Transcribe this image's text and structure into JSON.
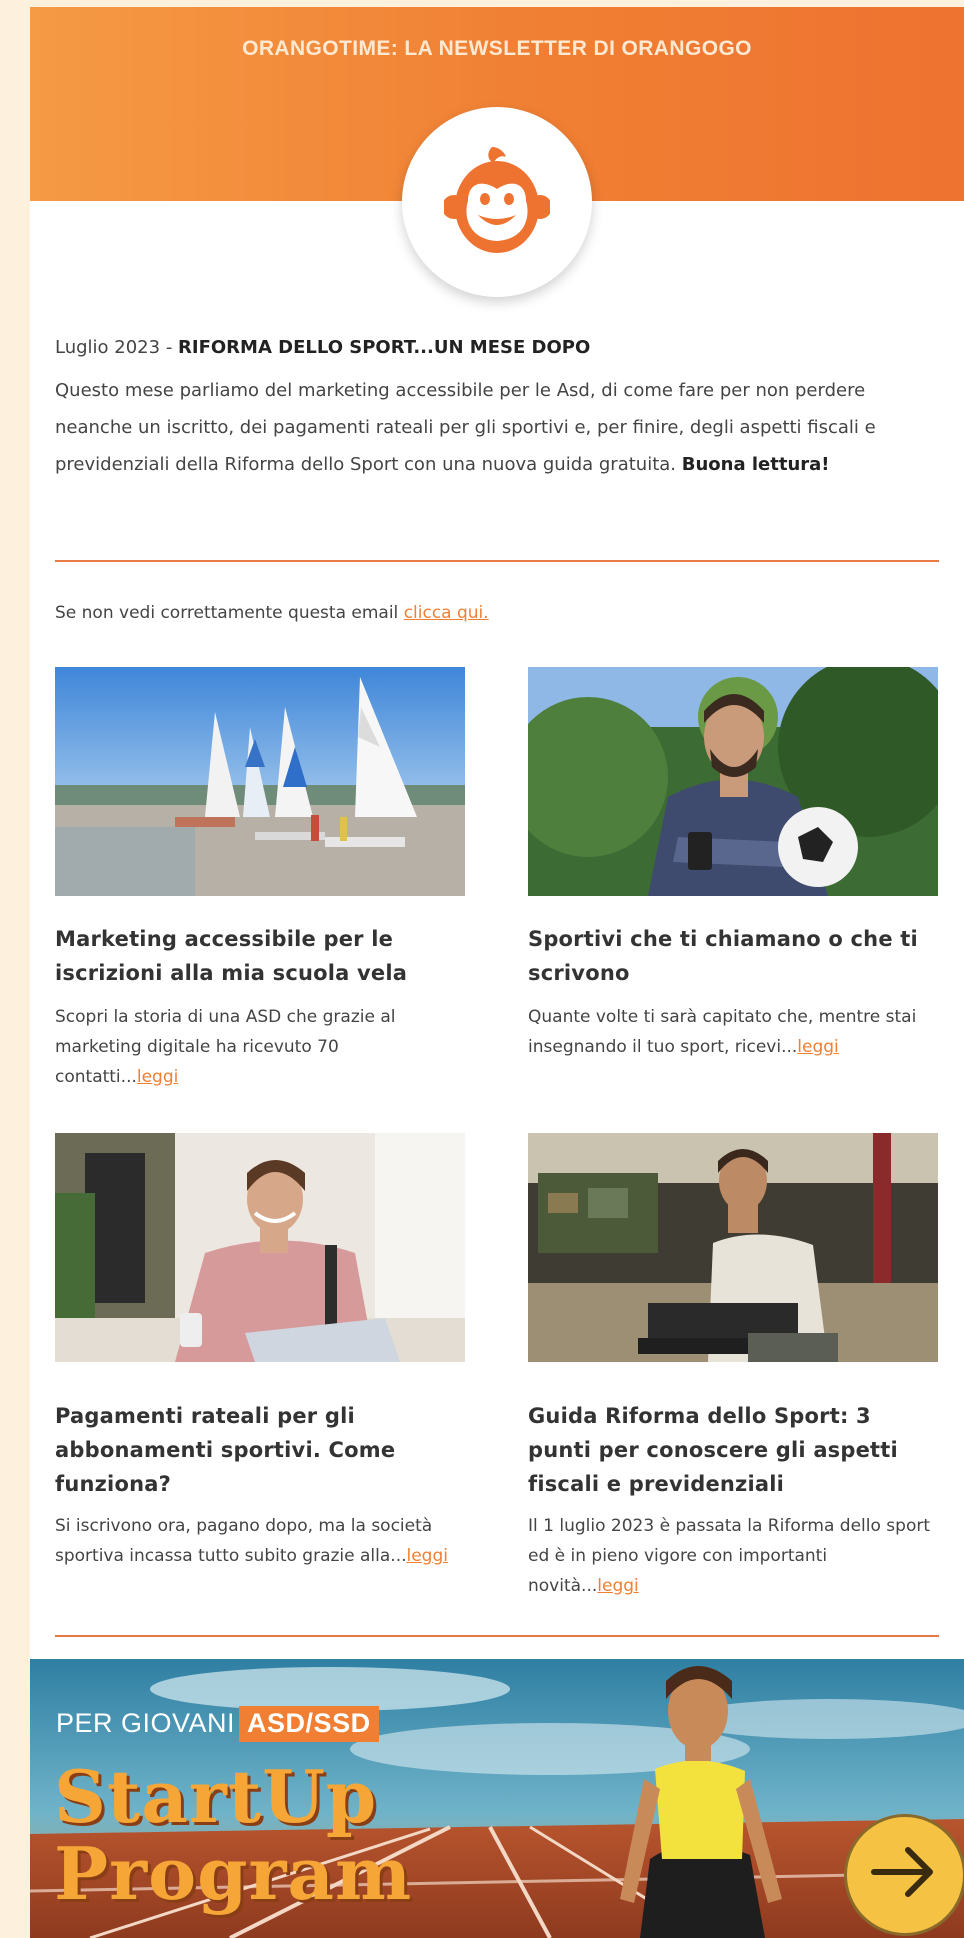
{
  "header": {
    "title": "ORANGOTIME: LA NEWSLETTER DI ORANGOGO"
  },
  "intro": {
    "date": "Luglio 2023 - ",
    "headline": "RIFORMA DELLO SPORT...UN MESE DOPO",
    "body": "Questo mese parliamo del marketing accessibile per le Asd, di come fare per non perdere neanche un iscritto, dei pagamenti rateali per gli sportivi e, per finire, degli aspetti fiscali e previdenziali della Riforma dello Sport con una nuova guida gratuita. ",
    "body_bold": "Buona lettura!"
  },
  "notice": {
    "text": "Se non vedi correttamente questa email ",
    "link": "clicca qui."
  },
  "articles": [
    {
      "title": "Marketing accessibile per le iscrizioni alla mia scuola vela",
      "text": "Scopri la storia di una ASD che grazie al marketing digitale ha ricevuto 70 contatti...",
      "link": "leggi"
    },
    {
      "title": "Sportivi che ti chiamano o che ti scrivono",
      "text": "Quante volte ti sarà capitato che, mentre stai insegnando il tuo sport, ricevi...",
      "link": "leggi"
    },
    {
      "title": "Pagamenti rateali per gli abbonamenti sportivi. Come funziona?",
      "text": "Si iscrivono ora, pagano dopo, ma la società sportiva incassa tutto subito grazie alla...",
      "link": "leggi"
    },
    {
      "title": "Guida Riforma dello Sport: 3 punti per conoscere gli aspetti fiscali e previdenziali",
      "text": "Il 1 luglio 2023 è passata la Riforma dello sport ed è in pieno vigore con importanti novità...",
      "link": "leggi"
    }
  ],
  "banner": {
    "subtitle": "PER GIOVANI",
    "tag": "ASD/SSD",
    "line1": "StartUp",
    "line2": "Program"
  },
  "colors": {
    "brand_orange": "#f07f33",
    "page_background": "#fdf0dc"
  },
  "icons": {
    "logo": "monkey-face-icon",
    "banner_button": "arrow-right-icon"
  }
}
